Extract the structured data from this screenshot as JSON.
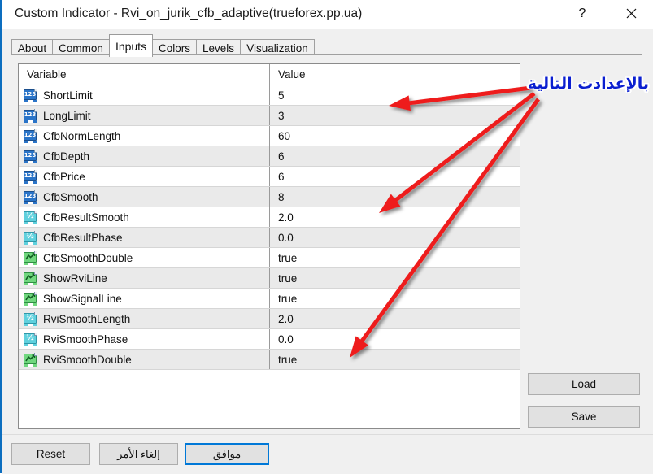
{
  "window": {
    "title": "Custom Indicator - Rvi_on_jurik_cfb_adaptive(trueforex.pp.ua)",
    "help_label": "?",
    "close_label": "close-icon"
  },
  "tabs": [
    {
      "label": "About",
      "active": false
    },
    {
      "label": "Common",
      "active": false
    },
    {
      "label": "Inputs",
      "active": true
    },
    {
      "label": "Colors",
      "active": false
    },
    {
      "label": "Levels",
      "active": false
    },
    {
      "label": "Visualization",
      "active": false
    }
  ],
  "table": {
    "headers": {
      "variable": "Variable",
      "value": "Value"
    },
    "rows": [
      {
        "type": "int",
        "variable": "ShortLimit",
        "value": "5"
      },
      {
        "type": "int",
        "variable": "LongLimit",
        "value": "3"
      },
      {
        "type": "int",
        "variable": "CfbNormLength",
        "value": "60"
      },
      {
        "type": "int",
        "variable": "CfbDepth",
        "value": "6"
      },
      {
        "type": "int",
        "variable": "CfbPrice",
        "value": "6"
      },
      {
        "type": "int",
        "variable": "CfbSmooth",
        "value": "8"
      },
      {
        "type": "double",
        "variable": "CfbResultSmooth",
        "value": "2.0"
      },
      {
        "type": "double",
        "variable": "CfbResultPhase",
        "value": "0.0"
      },
      {
        "type": "bool",
        "variable": "CfbSmoothDouble",
        "value": "true"
      },
      {
        "type": "bool",
        "variable": "ShowRviLine",
        "value": "true"
      },
      {
        "type": "bool",
        "variable": "ShowSignalLine",
        "value": "true"
      },
      {
        "type": "double",
        "variable": "RviSmoothLength",
        "value": "2.0"
      },
      {
        "type": "double",
        "variable": "RviSmoothPhase",
        "value": "0.0"
      },
      {
        "type": "bool",
        "variable": "RviSmoothDouble",
        "value": "true"
      }
    ]
  },
  "side_buttons": {
    "load": "Load",
    "save": "Save"
  },
  "footer": {
    "reset": "Reset",
    "cancel": "إلغاء الأمر",
    "ok": "موافق"
  },
  "annotation": {
    "text": "بالإعدادت التالية",
    "color": "#0b1fd0",
    "arrow_color": "#ee1c1c"
  }
}
